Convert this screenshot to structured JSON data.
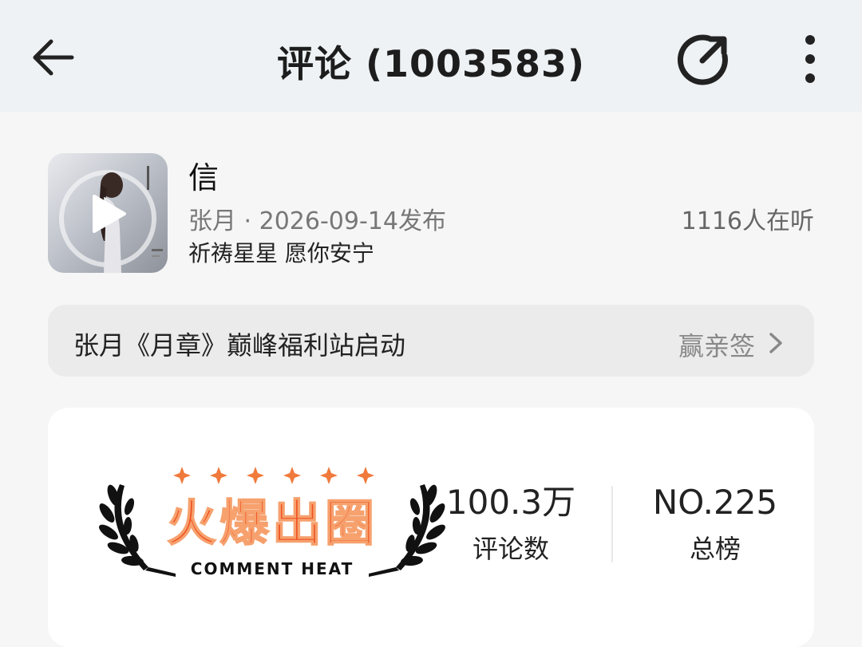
{
  "header": {
    "title": "评论 (1003583)",
    "back_icon": "back-arrow-icon",
    "share_icon": "share-icon",
    "more_icon": "more-vertical-icon"
  },
  "song": {
    "name": "信",
    "meta": "张月 · 2026-09-14发布",
    "slogan": "祈祷星星 愿你安宁",
    "listeners": "1116人在听",
    "cover_icon": "play-icon"
  },
  "banner": {
    "text": "张月《月章》巅峰福利站启动",
    "action": "赢亲签"
  },
  "heat": {
    "badge_title": "火爆出圈",
    "badge_subtitle": "COMMENT HEAT",
    "comments_value": "100.3万",
    "comments_label": "评论数",
    "rank_value": "NO.225",
    "rank_label": "总榜"
  },
  "colors": {
    "header_bg": "#eef2f4",
    "accent": "#ef4f1f",
    "page_bg": "#f6f6f6"
  }
}
